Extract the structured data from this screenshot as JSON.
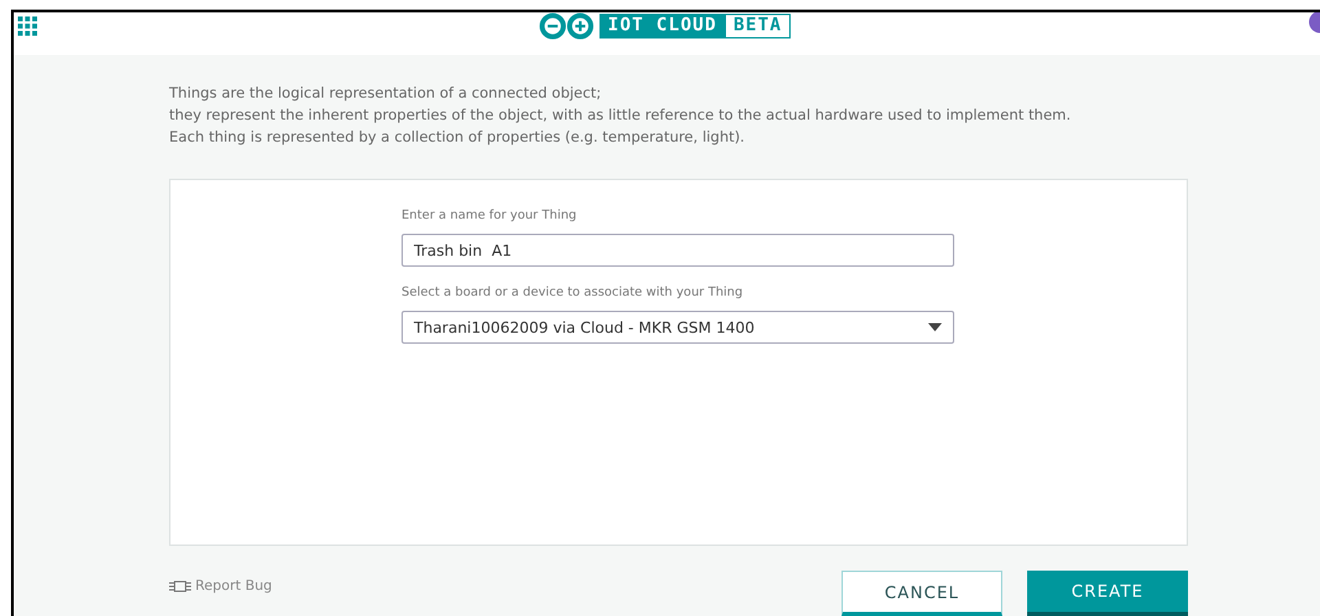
{
  "header": {
    "logo_text": "IOT CLOUD",
    "logo_badge": "BETA"
  },
  "intro": [
    "Things are the logical representation of a connected object;",
    "they represent the inherent properties of the object, with as little reference to the actual hardware used to implement them.",
    "Each thing is represented by a collection of properties (e.g. temperature, light)."
  ],
  "form": {
    "name_label": "Enter a name for your Thing",
    "name_value": "Trash bin  A1",
    "board_label": "Select a board or a device to associate with your Thing",
    "board_value": "Tharani10062009 via Cloud - MKR GSM 1400"
  },
  "footer": {
    "report_bug": "Report Bug",
    "buttons": [
      {
        "label": "CANCEL",
        "kind": "secondary"
      },
      {
        "label": "CREATE",
        "kind": "primary"
      }
    ]
  }
}
